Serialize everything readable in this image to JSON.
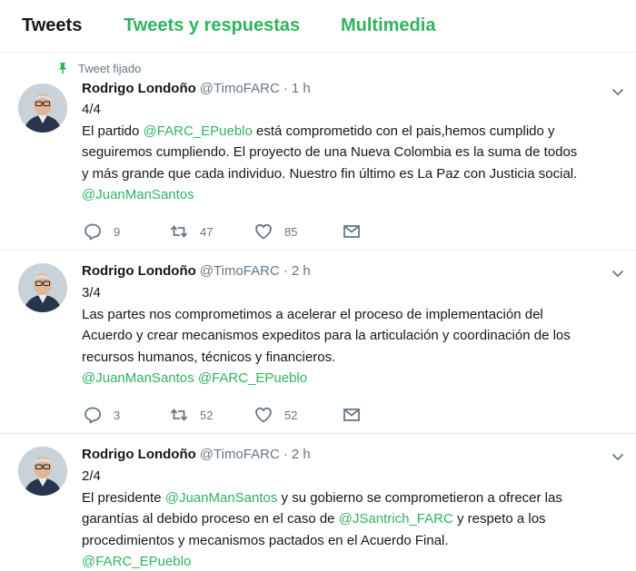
{
  "tabs": [
    {
      "label": "Tweets"
    },
    {
      "label": "Tweets y respuestas"
    },
    {
      "label": "Multimedia"
    }
  ],
  "colors": {
    "accent": "#2fb35f",
    "text": "#14171a",
    "muted": "#657786",
    "divider": "#e6ecf0"
  },
  "pinned_label": "Tweet fijado",
  "tweets": [
    {
      "name": "Rodrigo Londoño",
      "handle": "@TimoFARC",
      "dot": "·",
      "time": "1 h",
      "lines": [
        [
          {
            "t": "4/4",
            "m": false
          }
        ],
        [
          {
            "t": "El partido ",
            "m": false
          },
          {
            "t": "@FARC_EPueblo",
            "m": true
          },
          {
            "t": " está comprometido con el pais,hemos cumplido y",
            "m": false
          }
        ],
        [
          {
            "t": "seguiremos cumpliendo. El proyecto de una Nueva Colombia es la suma de todos",
            "m": false
          }
        ],
        [
          {
            "t": "y más grande que cada individuo. Nuestro fin último es La Paz con Justicia social.",
            "m": false
          }
        ],
        [
          {
            "t": "@JuanManSantos",
            "m": true
          }
        ]
      ],
      "replies": "9",
      "retweets": "47",
      "likes": "85"
    },
    {
      "name": "Rodrigo Londoño",
      "handle": "@TimoFARC",
      "dot": "·",
      "time": "2 h",
      "lines": [
        [
          {
            "t": "3/4",
            "m": false
          }
        ],
        [
          {
            "t": "Las partes nos comprometimos a acelerar el proceso de implementación del",
            "m": false
          }
        ],
        [
          {
            "t": "Acuerdo y crear mecanismos expeditos para la articulación y coordinación de los",
            "m": false
          }
        ],
        [
          {
            "t": "recursos humanos, técnicos y financieros.",
            "m": false
          }
        ],
        [
          {
            "t": "@JuanManSantos",
            "m": true
          },
          {
            "t": " ",
            "m": false
          },
          {
            "t": "@FARC_EPueblo",
            "m": true
          }
        ]
      ],
      "replies": "3",
      "retweets": "52",
      "likes": "52"
    },
    {
      "name": "Rodrigo Londoño",
      "handle": "@TimoFARC",
      "dot": "·",
      "time": "2 h",
      "lines": [
        [
          {
            "t": "2/4",
            "m": false
          }
        ],
        [
          {
            "t": "El presidente ",
            "m": false
          },
          {
            "t": "@JuanManSantos",
            "m": true
          },
          {
            "t": " y su gobierno se comprometieron a ofrecer las",
            "m": false
          }
        ],
        [
          {
            "t": "garantías al debido proceso en el caso de ",
            "m": false
          },
          {
            "t": "@JSantrich_FARC",
            "m": true
          },
          {
            "t": " y respeto a los",
            "m": false
          }
        ],
        [
          {
            "t": "procedimientos y mecanismos pactados en el Acuerdo Final.",
            "m": false
          }
        ],
        [
          {
            "t": "@FARC_EPueblo",
            "m": true
          }
        ]
      ]
    }
  ]
}
